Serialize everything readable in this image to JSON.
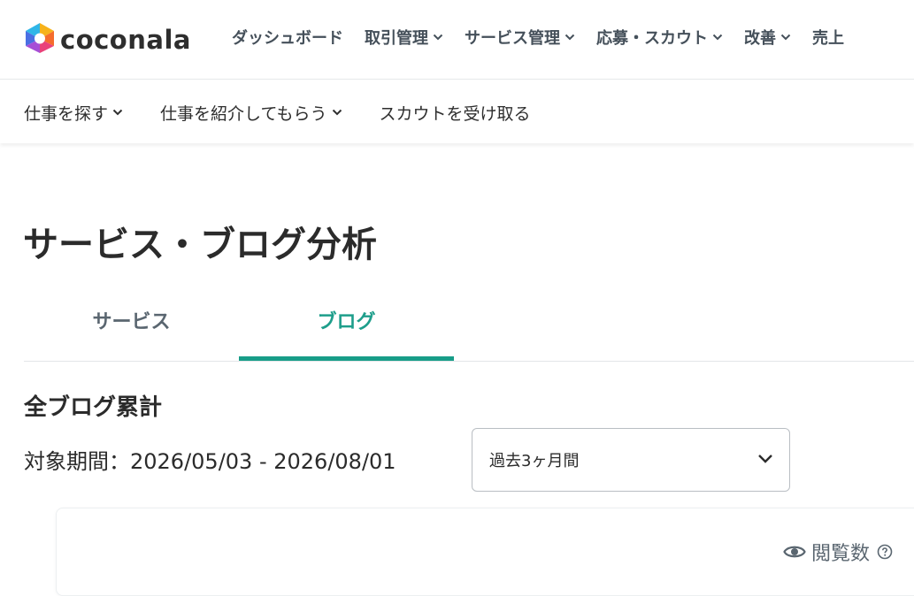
{
  "header": {
    "logo_text": "coconala",
    "nav": [
      {
        "label": "ダッシュボード",
        "has_dropdown": false
      },
      {
        "label": "取引管理",
        "has_dropdown": true
      },
      {
        "label": "サービス管理",
        "has_dropdown": true
      },
      {
        "label": "応募・スカウト",
        "has_dropdown": true
      },
      {
        "label": "改善",
        "has_dropdown": true
      },
      {
        "label": "売上",
        "has_dropdown": false
      }
    ]
  },
  "subnav": {
    "items": [
      {
        "label": "仕事を探す",
        "has_dropdown": true
      },
      {
        "label": "仕事を紹介してもらう",
        "has_dropdown": true
      },
      {
        "label": "スカウトを受け取る",
        "has_dropdown": false
      }
    ]
  },
  "page": {
    "title": "サービス・ブログ分析",
    "tabs": [
      {
        "label": "サービス",
        "active": false
      },
      {
        "label": "ブログ",
        "active": true
      }
    ],
    "section_title": "全ブログ累計",
    "period_label": "対象期間：2026/05/03 - 2026/08/01",
    "period_select": {
      "value": "過去3ヶ月間"
    },
    "metric": {
      "label": "閲覧数"
    }
  },
  "colors": {
    "accent": "#179d88",
    "text": "#2b2b2b",
    "nav_text": "#45505a",
    "muted": "#5a6670"
  },
  "icons": {
    "logo": "coconala-logo-icon",
    "dropdown": "chevron-down-icon",
    "eye": "eye-icon",
    "help": "help-circle-icon"
  }
}
